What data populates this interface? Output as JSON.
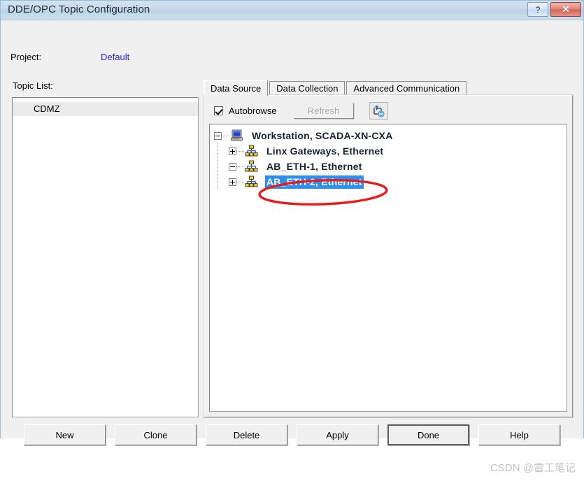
{
  "window": {
    "title": "DDE/OPC Topic Configuration",
    "help_button": "?",
    "close_button": "✕"
  },
  "project": {
    "label": "Project:",
    "value": "Default"
  },
  "topic_list": {
    "label": "Topic List:",
    "items": [
      "CDMZ"
    ]
  },
  "tabs": [
    {
      "label": "Data Source",
      "active": true
    },
    {
      "label": "Data Collection",
      "active": false
    },
    {
      "label": "Advanced Communication",
      "active": false
    }
  ],
  "toolbar": {
    "autobrowse_label": "Autobrowse",
    "autobrowse_checked": true,
    "refresh_label": "Refresh",
    "refresh_enabled": false,
    "browse_icon": "refresh-upload-icon"
  },
  "tree": {
    "nodes": [
      {
        "label": "Workstation, SCADA-XN-CXA",
        "icon": "workstation-computer-icon",
        "expander": "minus",
        "level": 0,
        "selected": false
      },
      {
        "label": "Linx Gateways, Ethernet",
        "icon": "network-hub-icon",
        "expander": "plus",
        "level": 1,
        "selected": false
      },
      {
        "label": "AB_ETH-1, Ethernet",
        "icon": "network-hub-icon",
        "expander": "minus",
        "level": 1,
        "selected": false
      },
      {
        "label": "AB_ETH-2, Ethernet",
        "icon": "network-hub-icon",
        "expander": "plus",
        "level": 1,
        "selected": true
      }
    ]
  },
  "annotation": {
    "shape": "red-ellipse-highlight",
    "color": "#e71d1d"
  },
  "buttons": [
    {
      "label": "New",
      "default": false
    },
    {
      "label": "Clone",
      "default": false
    },
    {
      "label": "Delete",
      "default": false
    },
    {
      "label": "Apply",
      "default": false
    },
    {
      "label": "Done",
      "default": true
    },
    {
      "label": "Help",
      "default": false
    }
  ],
  "watermark": "CSDN @雷工笔记",
  "colors": {
    "selection": "#2f8ff0",
    "link": "#2525d6",
    "annotation": "#e71d1d",
    "titlebar": "#c6daeb"
  }
}
